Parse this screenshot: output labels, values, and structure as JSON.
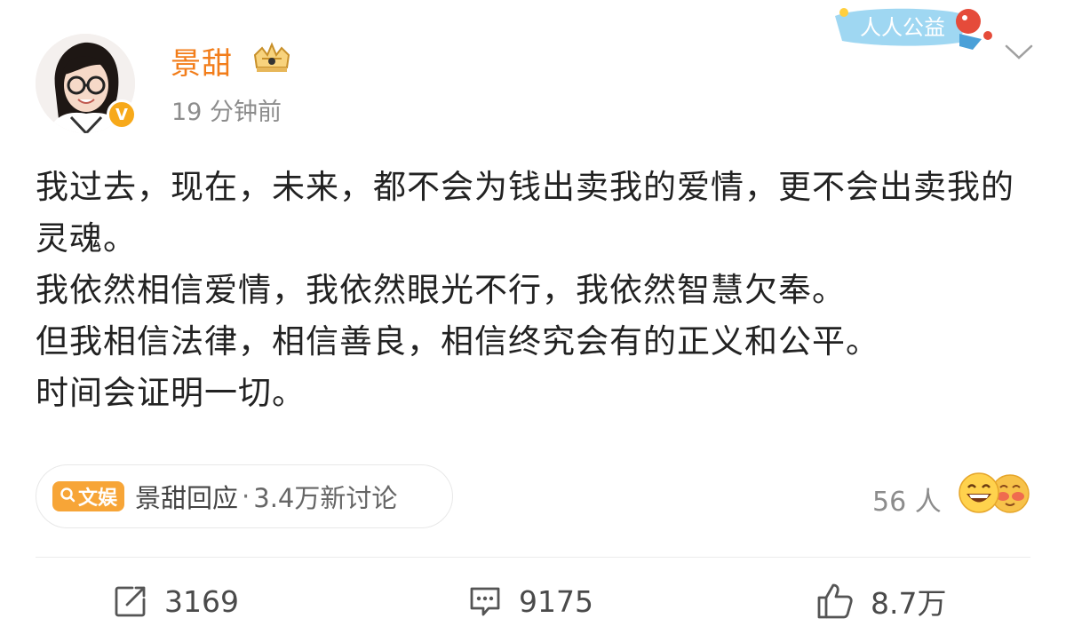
{
  "post": {
    "username": "景甜",
    "timestamp": "19 分钟前",
    "verified_mark": "V",
    "badge": "crown-icon",
    "charity_label": "人人公益",
    "paragraphs": [
      "我过去，现在，未来，都不会为钱出卖我的爱情，更不会出卖我的灵魂。",
      "我依然相信爱情，我依然眼光不行，我依然智慧欠奉。",
      "但我相信法律，相信善良，相信终究会有的正义和公平。",
      "时间会证明一切。"
    ]
  },
  "topic": {
    "tag_label": "文娱",
    "title": "景甜回应",
    "separator": "·",
    "discussion": "3.4万新讨论"
  },
  "reactions": {
    "count_label": "56 人",
    "emojis": [
      "grin-emoji-icon",
      "blush-emoji-icon"
    ]
  },
  "actions": {
    "repost_count": "3169",
    "comment_count": "9175",
    "like_count": "8.7万"
  },
  "colors": {
    "username": "#f27d1a",
    "verified": "#f7a91a",
    "topic_tag": "#f7a537",
    "muted_text": "#8c8c8c"
  }
}
